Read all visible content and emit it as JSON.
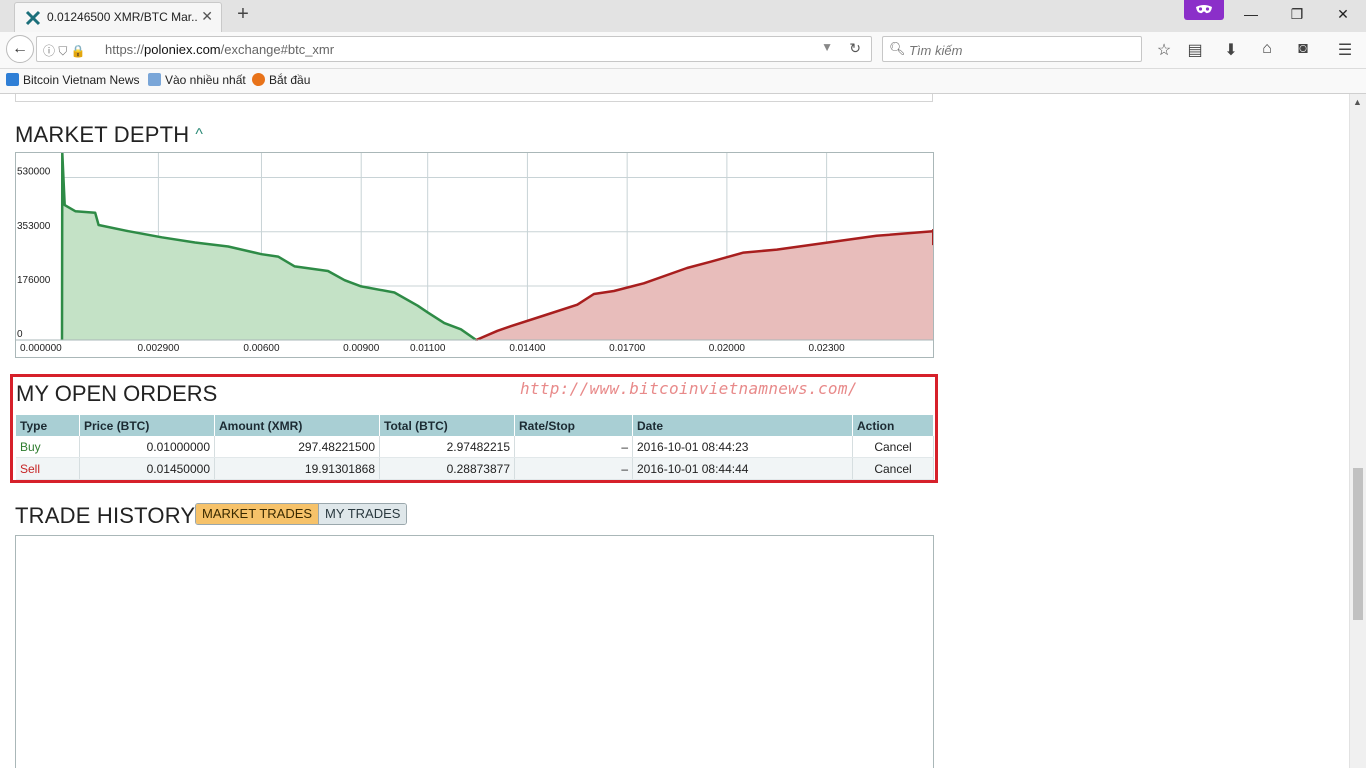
{
  "browser": {
    "tab_title": "0.01246500 XMR/BTC Mar...",
    "url_prefix": "https://",
    "url_domain": "poloniex.com",
    "url_path": "/exchange#btc_xmr",
    "search_placeholder": "Tìm kiếm",
    "bookmarks": [
      {
        "label": "Bitcoin Vietnam News"
      },
      {
        "label": "Vào nhiều nhất"
      },
      {
        "label": "Bắt đầu"
      }
    ]
  },
  "market_depth": {
    "title": "MARKET DEPTH"
  },
  "chart_data": {
    "type": "area",
    "title": "MARKET DEPTH",
    "xlim": [
      0.0,
      0.0262
    ],
    "ylim": [
      0,
      610000
    ],
    "x_ticks": [
      0.0,
      0.0029,
      0.006,
      0.009,
      0.011,
      0.014,
      0.017,
      0.02,
      0.023
    ],
    "x_tick_labels": [
      "0.000000",
      "0.002900",
      "0.00600",
      "0.00900",
      "0.01100",
      "0.01400",
      "0.01700",
      "0.02000",
      "0.02300"
    ],
    "y_ticks": [
      0,
      176000,
      353000,
      530000
    ],
    "y_tick_labels": [
      "0",
      "176000",
      "353000",
      "530000"
    ],
    "grid": true,
    "colors": {
      "bids_line": "#2e8b46",
      "bids_fill": "#c4e2c6",
      "asks_line": "#a81e1e",
      "asks_fill": "#e8bdbb"
    },
    "series": [
      {
        "side": "bids",
        "x": [
          0.0,
          1e-05,
          8e-05,
          0.0004,
          0.001,
          0.0011,
          0.002,
          0.003,
          0.004,
          0.005,
          0.006,
          0.0065,
          0.007,
          0.008,
          0.0085,
          0.009,
          0.01,
          0.0107,
          0.011,
          0.0115,
          0.012,
          0.01246
        ],
        "y": [
          0,
          610000,
          440000,
          420000,
          415000,
          375000,
          355000,
          335000,
          318000,
          305000,
          280000,
          272000,
          240000,
          225000,
          195000,
          175000,
          155000,
          112000,
          90000,
          55000,
          35000,
          0
        ]
      },
      {
        "side": "asks",
        "x": [
          0.01246,
          0.0131,
          0.0135,
          0.0145,
          0.0155,
          0.016,
          0.0166,
          0.0175,
          0.0188,
          0.0195,
          0.0205,
          0.0215,
          0.0225,
          0.0235,
          0.0245,
          0.0262
        ],
        "y": [
          0,
          30000,
          45000,
          80000,
          115000,
          150000,
          160000,
          185000,
          235000,
          255000,
          285000,
          295000,
          310000,
          325000,
          340000,
          355000
        ]
      }
    ]
  },
  "open_orders": {
    "title": "MY OPEN ORDERS",
    "watermark": "http://www.bitcoinvietnamnews.com/",
    "columns": [
      "Type",
      "Price (BTC)",
      "Amount (XMR)",
      "Total (BTC)",
      "Rate/Stop",
      "Date",
      "Action"
    ],
    "rows": [
      {
        "type": "Buy",
        "price": "0.01000000",
        "amount": "297.48221500",
        "total": "2.97482215",
        "rate": "–",
        "date": "2016-10-01 08:44:23",
        "action": "Cancel"
      },
      {
        "type": "Sell",
        "price": "0.01450000",
        "amount": "19.91301868",
        "total": "0.28873877",
        "rate": "–",
        "date": "2016-10-01 08:44:44",
        "action": "Cancel"
      }
    ]
  },
  "trade_history": {
    "title": "TRADE HISTORY",
    "tab_market": "MARKET TRADES",
    "tab_my": "MY TRADES"
  }
}
